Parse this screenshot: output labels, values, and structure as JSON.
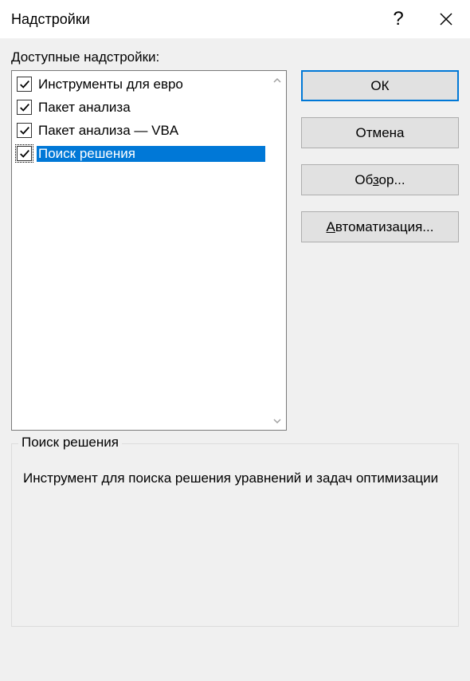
{
  "dialog": {
    "title": "Надстройки"
  },
  "list_label_prefix": "Д",
  "list_label_rest": "оступные надстройки:",
  "addins": [
    {
      "label": "Инструменты для евро",
      "checked": true,
      "selected": false
    },
    {
      "label": "Пакет анализа",
      "checked": true,
      "selected": false
    },
    {
      "label": "Пакет анализа — VBA",
      "checked": true,
      "selected": false
    },
    {
      "label": "Поиск решения",
      "checked": true,
      "selected": true
    }
  ],
  "buttons": {
    "ok": "ОК",
    "cancel": "Отмена",
    "browse_pre": "Об",
    "browse_u": "з",
    "browse_post": "ор...",
    "automation_u": "А",
    "automation_post": "втоматизация..."
  },
  "groupbox": {
    "legend": "Поиск решения",
    "description": "Инструмент для поиска решения уравнений и задач оптимизации"
  }
}
